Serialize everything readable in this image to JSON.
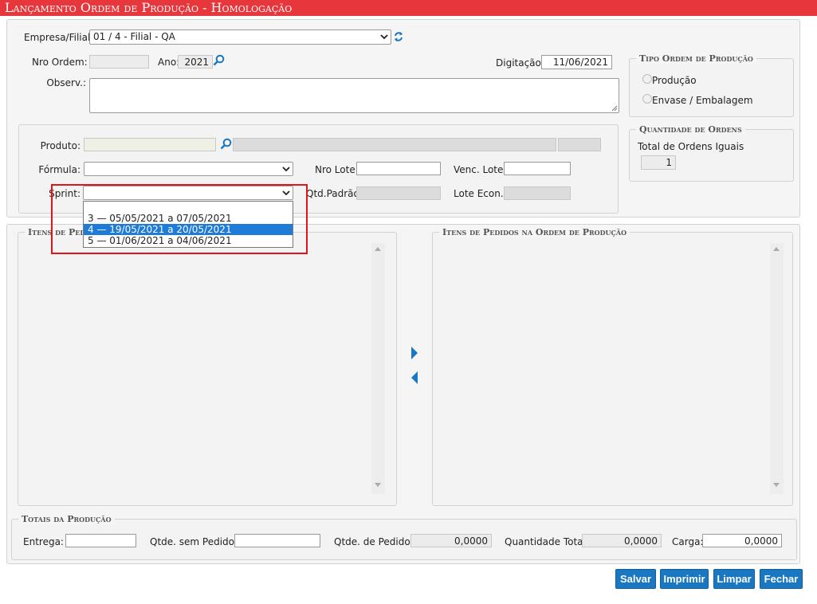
{
  "window": {
    "title": "Lançamento Ordem de Produção  - Homologação"
  },
  "header_form": {
    "empresa_label": "Empresa/Filial:",
    "empresa_value": "01 / 4 - Filial - QA",
    "nro_ordem_label": "Nro Ordem:",
    "nro_ordem_value": "",
    "ano_label": "Ano:",
    "ano_value": "2021",
    "digitacao_label": "Digitação:",
    "digitacao_value": "11/06/2021",
    "observ_label": "Observ.:",
    "observ_value": ""
  },
  "tipo_ordem": {
    "legend": "Tipo Ordem de Produção",
    "options": [
      "Produção",
      "Envase / Embalagem"
    ]
  },
  "produto_form": {
    "produto_label": "Produto:",
    "formula_label": "Fórmula:",
    "nro_lote_label": "Nro Lote:",
    "venc_lote_label": "Venc. Lote:",
    "sprint_label": "Sprint:",
    "qtd_padrao_label": "Qtd.Padrão:",
    "lote_econ_label": "Lote Econ.:"
  },
  "quantidade_ordens": {
    "legend": "Quantidade de Ordens",
    "total_label": "Total de Ordens Iguais",
    "total_value": "1"
  },
  "sprint_dropdown": {
    "options": [
      "",
      "3 — 05/05/2021 a 07/05/2021",
      "4 — 19/05/2021 a 20/05/2021",
      "5 — 01/06/2021 a 04/06/2021"
    ],
    "highlighted_index": 2
  },
  "itens_pedidos": {
    "legend": "Itens de Pedidos"
  },
  "itens_ordem": {
    "legend": "Itens de Pedidos na Ordem de Produção"
  },
  "totais": {
    "legend": "Totais da Produção",
    "entrega_label": "Entrega:",
    "entrega_value": "",
    "qtde_sem_pedidos_label": "Qtde. sem Pedidos:",
    "qtde_sem_pedidos_value": "",
    "qtde_pedidos_label": "Qtde. de Pedidos:",
    "qtde_pedidos_value": "0,0000",
    "quantidade_total_label": "Quantidade Total:",
    "quantidade_total_value": "0,0000",
    "carga_label": "Carga:",
    "carga_value": "0,0000"
  },
  "actions": {
    "salvar": "Salvar",
    "imprimir": "Imprimir",
    "limpar": "Limpar",
    "fechar": "Fechar"
  },
  "colors": {
    "title_bar": "#e8363d",
    "button": "#1a78c2",
    "highlight": "#1e7bd8",
    "annotation": "#e0151c"
  }
}
